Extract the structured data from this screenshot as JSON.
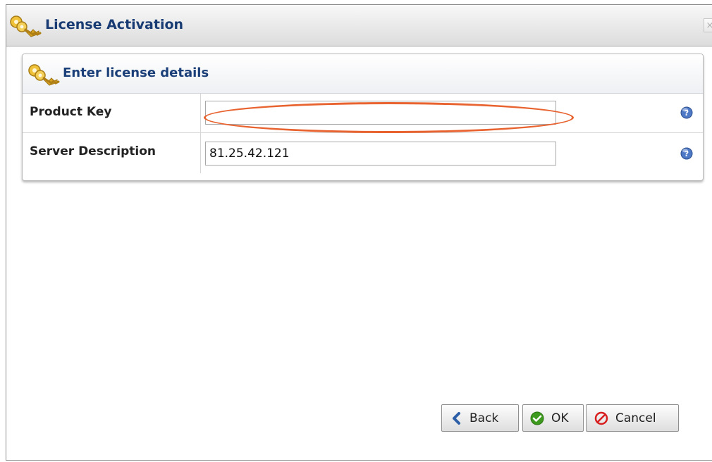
{
  "window": {
    "title": "License Activation",
    "title_icon": "keys-icon",
    "close_label": "×"
  },
  "panel": {
    "title": "Enter license details",
    "title_icon": "keys-icon"
  },
  "form": {
    "product_key": {
      "label": "Product Key",
      "value": "",
      "help_icon": "help-icon"
    },
    "server_description": {
      "label": "Server Description",
      "value": "81.25.42.121",
      "help_icon": "help-icon"
    }
  },
  "buttons": {
    "back": {
      "label": "Back",
      "icon": "chevron-left-icon"
    },
    "ok": {
      "label": "OK",
      "icon": "check-circle-icon"
    },
    "cancel": {
      "label": "Cancel",
      "icon": "cancel-circle-icon"
    }
  },
  "colors": {
    "title_text": "#173b72",
    "highlight": "#e8632f",
    "ok_green": "#3e9a1f",
    "cancel_red": "#d81f1f",
    "back_blue": "#2d5fa8",
    "help_blue": "#4e79c7"
  }
}
